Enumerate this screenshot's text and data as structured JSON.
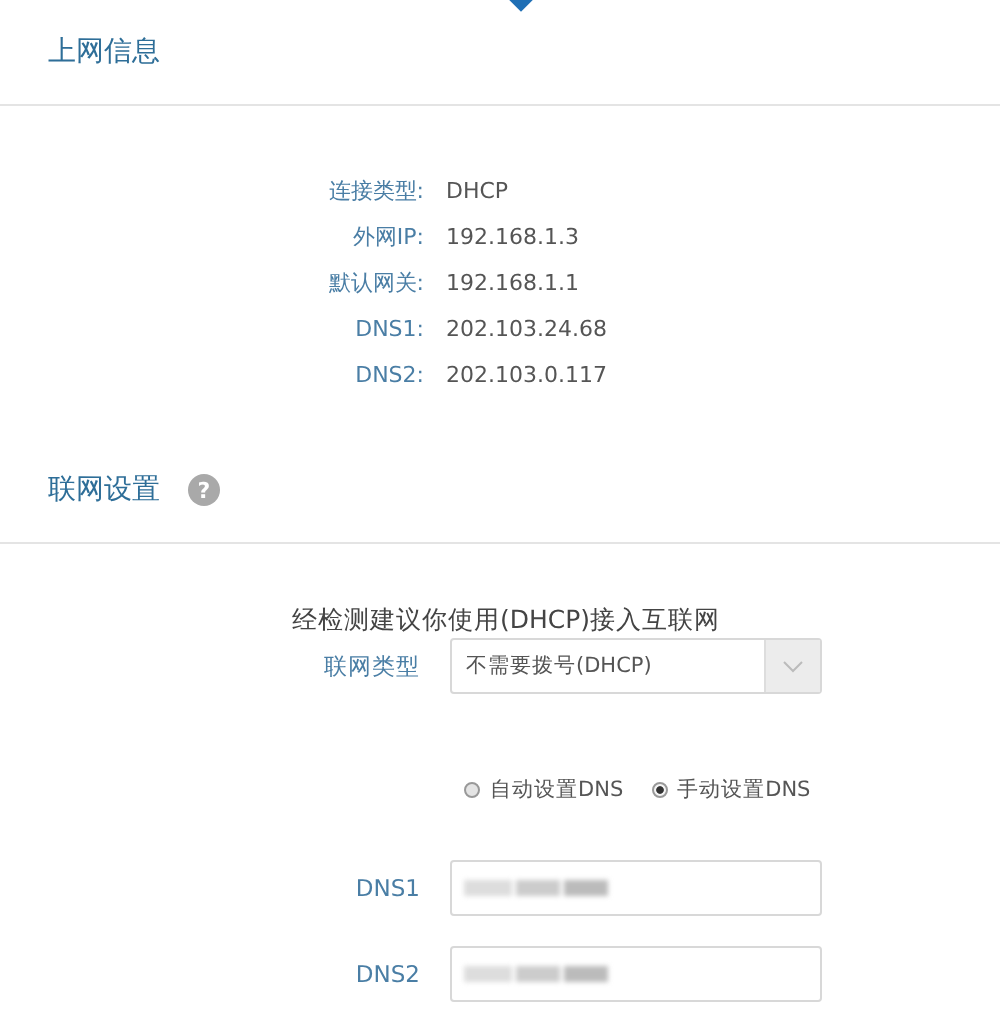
{
  "status_section": {
    "title": "上网信息",
    "rows": [
      {
        "label": "连接类型:",
        "value": "DHCP"
      },
      {
        "label": "外网IP:",
        "value": "192.168.1.3"
      },
      {
        "label": "默认网关:",
        "value": "192.168.1.1"
      },
      {
        "label": "DNS1:",
        "value": "202.103.24.68"
      },
      {
        "label": "DNS2:",
        "value": "202.103.0.117"
      }
    ]
  },
  "settings_section": {
    "title": "联网设置",
    "help_icon": "?",
    "notice": "经检测建议你使用(DHCP)接入互联网",
    "connection_type": {
      "label": "联网类型",
      "value": "不需要拨号(DHCP)"
    },
    "dns_mode": [
      {
        "label": "自动设置DNS",
        "selected": false
      },
      {
        "label": "手动设置DNS",
        "selected": true
      }
    ],
    "dns_fields": [
      {
        "label": "DNS1"
      },
      {
        "label": "DNS2"
      }
    ]
  }
}
